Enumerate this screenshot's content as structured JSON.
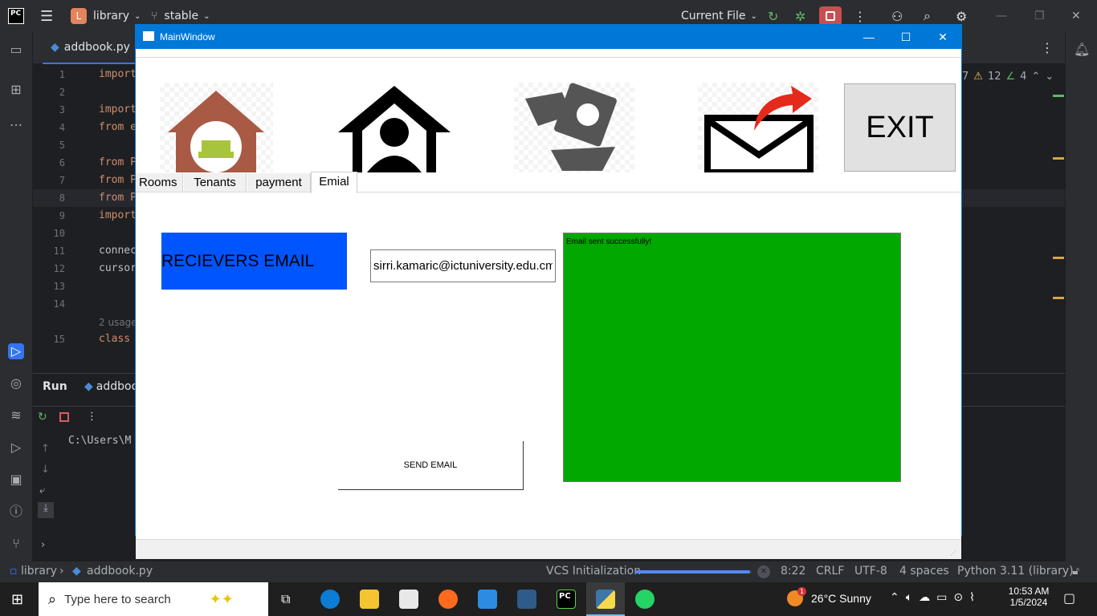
{
  "ide": {
    "project_badge": "L",
    "project_name": "library",
    "branch": "stable",
    "run_config": "Current File",
    "file_tab": "addbook.py",
    "inspections": {
      "warnings": "12",
      "weak": "4",
      "errors_partial": "7"
    },
    "code_lines": [
      {
        "n": "1",
        "text": "import"
      },
      {
        "n": "2",
        "text": ""
      },
      {
        "n": "3",
        "text": "import"
      },
      {
        "n": "4",
        "text": "from e"
      },
      {
        "n": "5",
        "text": ""
      },
      {
        "n": "6",
        "text": "from P"
      },
      {
        "n": "7",
        "text": "from P"
      },
      {
        "n": "8",
        "text": "from P"
      },
      {
        "n": "9",
        "text": "import"
      },
      {
        "n": "10",
        "text": ""
      },
      {
        "n": "11",
        "text": "connec"
      },
      {
        "n": "12",
        "text": "cursor"
      },
      {
        "n": "13",
        "text": ""
      },
      {
        "n": "14",
        "text": ""
      },
      {
        "n": "15",
        "text": "class "
      }
    ],
    "usages_hint": "2 usage",
    "run_panel": {
      "title": "Run",
      "tab": "addboo",
      "console_text": "C:\\Users\\M"
    },
    "status": {
      "breadcrumb_project": "library",
      "breadcrumb_file": "addbook.py",
      "task": "VCS Initialization",
      "task_progress": 0.98,
      "position": "8:22",
      "line_sep": "CRLF",
      "encoding": "UTF-8",
      "indent": "4 spaces",
      "interpreter": "Python 3.11 (library)"
    }
  },
  "app": {
    "window_title": "MainWindow",
    "tabs": [
      "Rooms",
      "Tenants",
      "payment",
      "Emial"
    ],
    "active_tab": "Emial",
    "exit_label": "EXIT",
    "receivers_label": "RECIEVERS EMAIL",
    "email_value": "sirri.kamaric@ictuniversity.edu.cm",
    "send_label": "SEND EMAIL",
    "output_text": "Email sent successfully!",
    "colors": {
      "label_bg": "#0055ff",
      "output_bg": "#00a800",
      "titlebar": "#0078d7"
    },
    "images": [
      "house-sofa-icon",
      "home-person-icon",
      "money-hand-icon",
      "envelope-send-icon"
    ]
  },
  "taskbar": {
    "search_placeholder": "Type here to search",
    "weather": "26°C  Sunny",
    "weather_badge": "1",
    "time": "10:53 AM",
    "date": "1/5/2024"
  }
}
